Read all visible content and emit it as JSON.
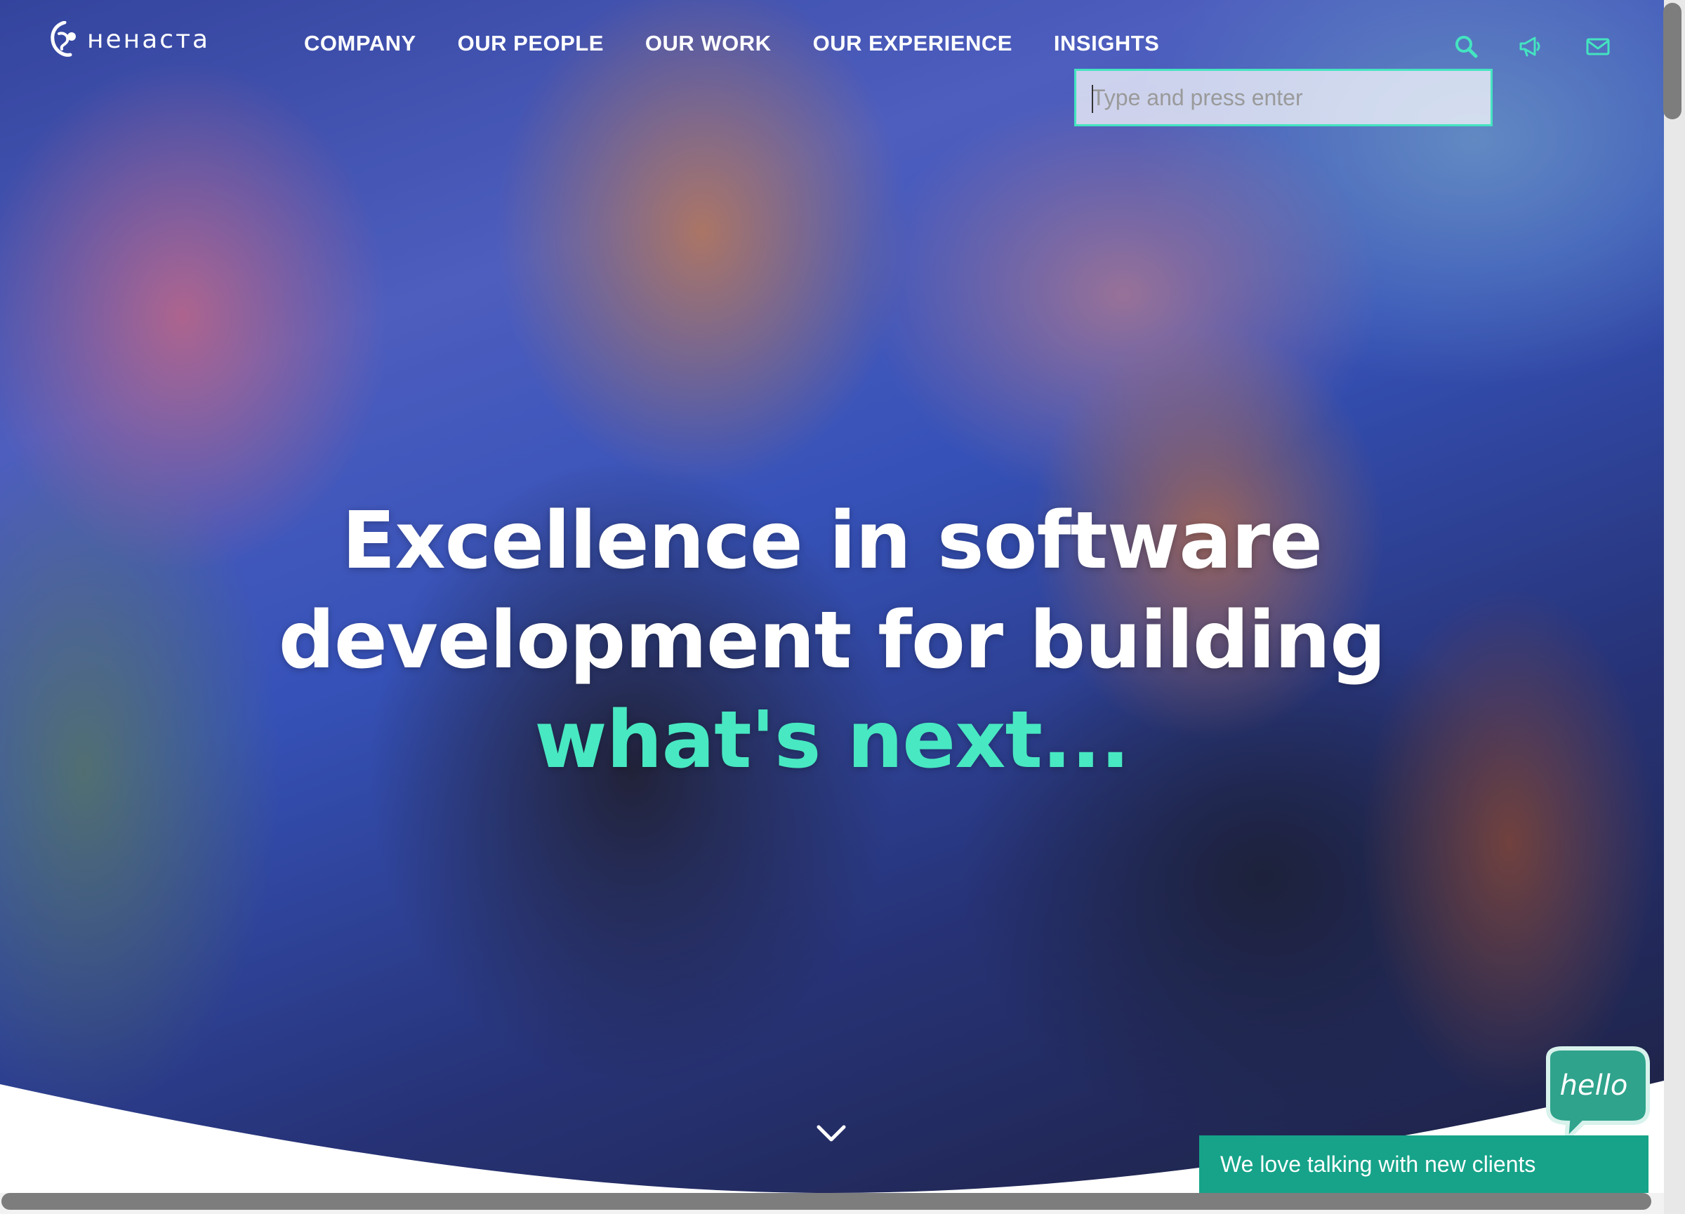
{
  "header": {
    "logo_text": "нeнacтa",
    "nav": [
      {
        "label": "COMPANY"
      },
      {
        "label": "OUR PEOPLE"
      },
      {
        "label": "OUR WORK"
      },
      {
        "label": "OUR EXPERIENCE"
      },
      {
        "label": "INSIGHTS"
      }
    ],
    "icons": [
      "search-icon",
      "megaphone-icon",
      "mail-icon"
    ],
    "search": {
      "placeholder": "Type and press enter",
      "value": ""
    }
  },
  "hero": {
    "line1": "Excellence in software",
    "line2": "development for building",
    "accent": "what's next..."
  },
  "chat": {
    "bubble_text": "hello",
    "bar_text": "We love talking with new clients"
  },
  "colors": {
    "accent": "#48e8c2",
    "chat_green": "#16a389",
    "search_border": "#44e4c0"
  }
}
